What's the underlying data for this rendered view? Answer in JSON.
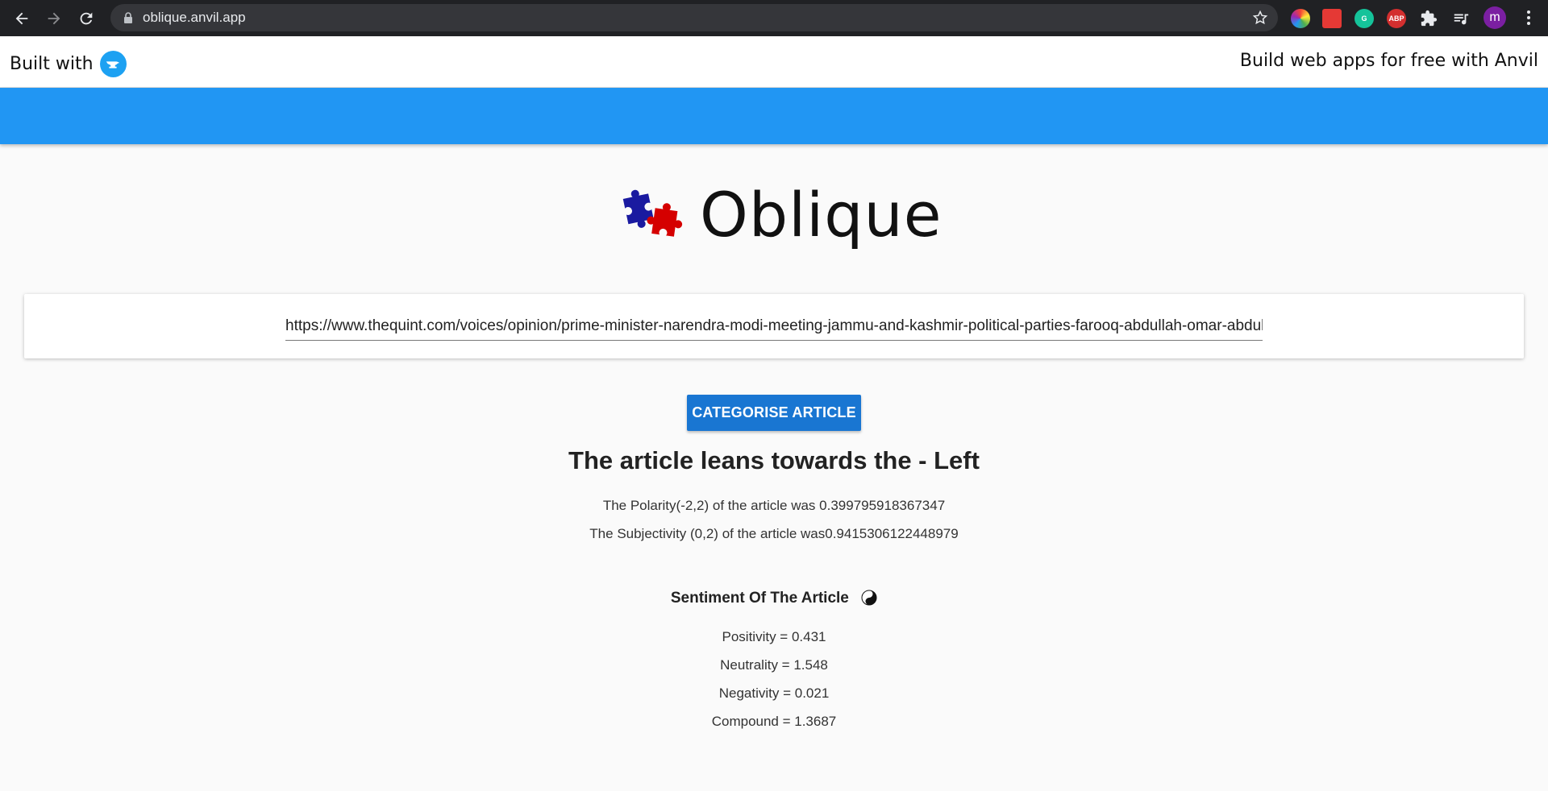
{
  "browser": {
    "url": "oblique.anvil.app",
    "profile_initial": "m",
    "extensions": [
      "color-icon",
      "pdf-icon",
      "grammarly-icon",
      "abp-icon",
      "puzzle-icon",
      "media-icon"
    ],
    "abp_label": "ABP"
  },
  "anvil_banner": {
    "built_with": "Built with",
    "build_free": "Build web apps for free with Anvil"
  },
  "app": {
    "logo_text": "Oblique",
    "article_url": "https://www.thequint.com/voices/opinion/prime-minister-narendra-modi-meeting-jammu-and-kashmir-political-parties-farooq-abdullah-omar-abdullah",
    "button_label": "CATEGORISE ARTICLE",
    "lean_text": "The article leans towards the - Left",
    "polarity_text": "The Polarity(-2,2)  of the article was 0.399795918367347",
    "subjectivity_text": "The Subjectivity (0,2)  of the article was0.9415306122448979",
    "sentiment_title": "Sentiment Of The Article",
    "positivity": "Positivity = 0.431",
    "neutrality": "Neutrality = 1.548",
    "negativity": "Negativity = 0.021",
    "compound": "Compound = 1.3687"
  },
  "colors": {
    "header_blue": "#2196f3",
    "button_blue": "#1976d2",
    "chrome_dark": "#202124"
  }
}
